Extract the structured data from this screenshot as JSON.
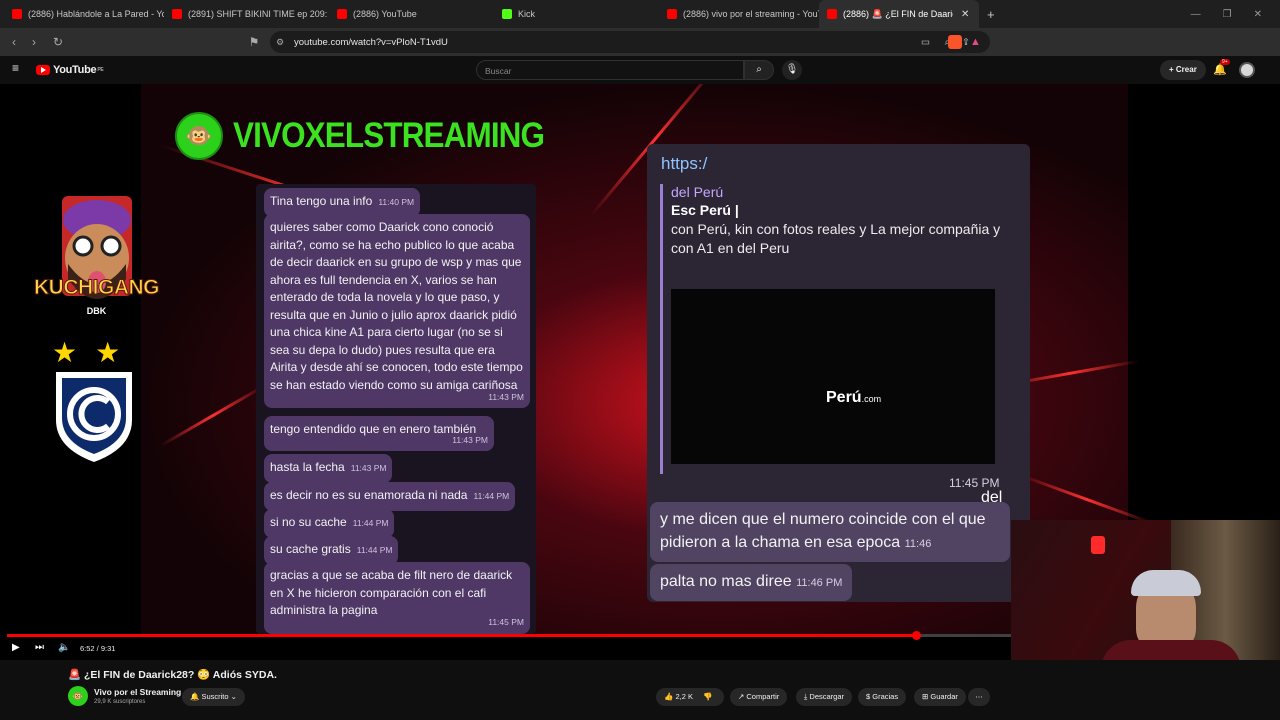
{
  "browser": {
    "tabs": [
      {
        "label": "(2886) Hablándole a La Pared - YouTu",
        "favicon": "youtube-icon"
      },
      {
        "label": "(2891) SHIFT BIKINI TIME ep 209: CA",
        "favicon": "youtube-icon"
      },
      {
        "label": "(2886) YouTube",
        "favicon": "youtube-icon"
      },
      {
        "label": "Kick",
        "favicon": "kick-icon"
      },
      {
        "label": "(2886) vivo por el streaming - YouTu",
        "favicon": "youtube-icon"
      },
      {
        "label": "(2886) 🚨 ¿El FIN de Daarick28?",
        "favicon": "youtube-icon"
      }
    ],
    "url": "youtube.com/watch?v=vPloN-T1vdU"
  },
  "youtube": {
    "logo": "YouTube",
    "region": "PE",
    "search_placeholder": "Buscar",
    "create_label": "Crear",
    "notif_count": "9+"
  },
  "video": {
    "brand_text": "VIVOXELSTREAMING",
    "left_chat": [
      {
        "text": "Tina tengo una info",
        "time": "11:40 PM"
      },
      {
        "text": "quieres saber como Daarick cono conoció airita?, como se ha echo publico lo que acaba de decir daarick en su grupo de wsp y mas que ahora es full tendencia en X, varios se han enterado de toda la novela y lo que paso, y resulta que en Junio o julio aprox daarick pidió una chica kine A1 para cierto lugar (no se si sea su depa lo dudo) pues resulta que era Airita y desde ahí se conocen, todo este tiempo se han estado viendo como su amiga cariñosa",
        "time": "11:43 PM"
      },
      {
        "text": "tengo entendido que en enero también",
        "time": "11:43 PM"
      },
      {
        "text": "hasta la fecha",
        "time": "11:43 PM"
      },
      {
        "text": "es decir no es su enamorada ni nada",
        "time": "11:44 PM"
      },
      {
        "text": "si no su cache",
        "time": "11:44 PM"
      },
      {
        "text": "su cache gratis",
        "time": "11:44 PM"
      },
      {
        "text": "gracias a que se acaba de filt          nero de daarick en X he hicieron comparación con el cafi        administra la pagina",
        "time": "11:45 PM"
      }
    ],
    "right_chat": {
      "link": "https:/",
      "preview_site": "del Perú",
      "preview_title": "Esc      Perú |",
      "preview_desc": "con Perú, kin         con fotos reales y                 La mejor compañia y         con        A1 en              del Peru",
      "preview_logo_del": "del",
      "preview_logo_peru": "Perú",
      "preview_logo_com": ".com",
      "time1": "11:45 PM",
      "msg2": "y me dicen que el numero coincide con el que pidieron a la chama en esa epoca",
      "time2": "11:46",
      "msg3": "palta no mas diree",
      "time3": "11:46 PM"
    },
    "side_text_1": "KUCHIGANG",
    "side_text_2": "DBK",
    "time_display": "6:52 / 9:31",
    "progress": 0.905
  },
  "watch": {
    "title": "🚨 ¿El FIN de Daarick28? 😳 Adiós SYDA.",
    "channel": "Vivo por el Streaming",
    "subscribers": "29,9 K suscriptores",
    "subscribed_label": "Suscrito",
    "likes": "2,2 K",
    "share": "Compartir",
    "download": "Descargar",
    "thanks": "Gracias",
    "save": "Guardar"
  }
}
